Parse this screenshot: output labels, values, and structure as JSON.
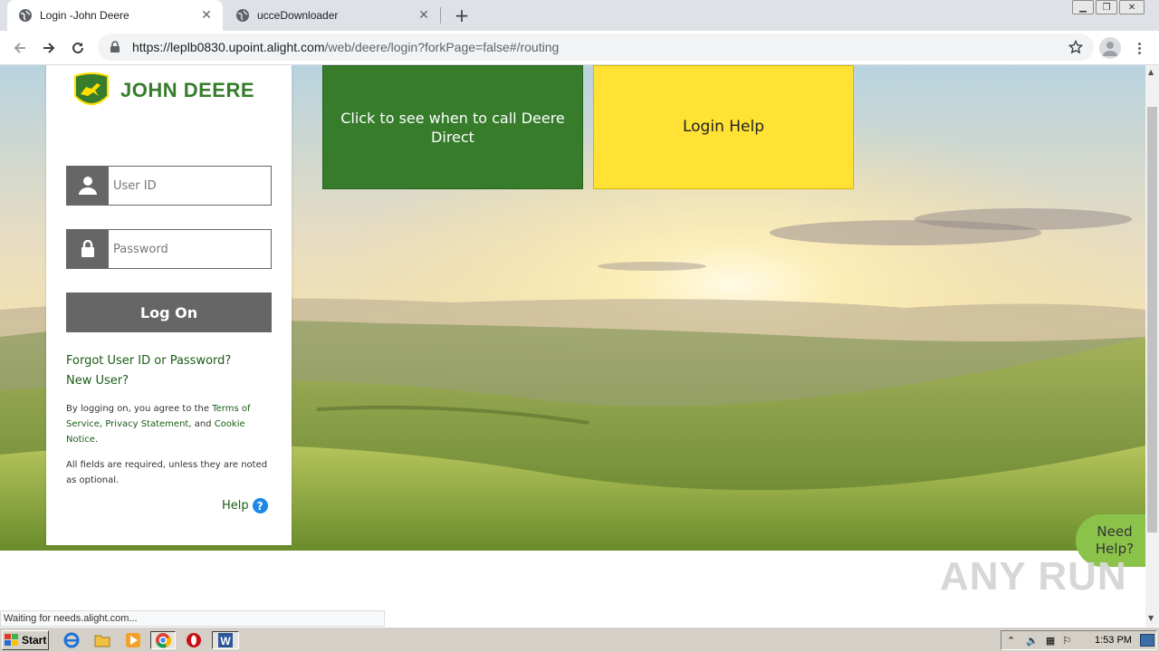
{
  "browser": {
    "tabs": [
      {
        "title": "Login -John Deere",
        "active": true
      },
      {
        "title": "ucceDownloader",
        "active": false
      }
    ],
    "url_host": "https://leplb0830.upoint.alight.com",
    "url_path": "/web/deere/login?forkPage=false#/routing",
    "status_text": "Waiting for needs.alight.com..."
  },
  "login": {
    "brand": "JOHN DEERE",
    "user_placeholder": "User ID",
    "password_placeholder": "Password",
    "logon_label": "Log On",
    "forgot_link": "Forgot User ID or Password?",
    "new_user_link": "New User?",
    "legal_prefix": "By logging on, you agree to the ",
    "terms_link": "Terms of Service",
    "legal_sep1": ", ",
    "privacy_link": "Privacy Statement",
    "legal_sep2": ", and ",
    "cookie_link": "Cookie Notice",
    "legal_end": ".",
    "required_note": "All fields are required, unless they are noted as optional.",
    "help_label": "Help",
    "help_symbol": "?"
  },
  "tiles": {
    "call_label": "Click to see when to call Deere Direct",
    "login_help_label": "Login Help"
  },
  "need_help": "Need Help?",
  "watermark": "ANY RUN",
  "taskbar": {
    "start_label": "Start",
    "clock": "1:53 PM"
  },
  "colors": {
    "deere_green": "#367c2b",
    "deere_yellow": "#ffe234",
    "need_help_green": "#8bc34a"
  }
}
